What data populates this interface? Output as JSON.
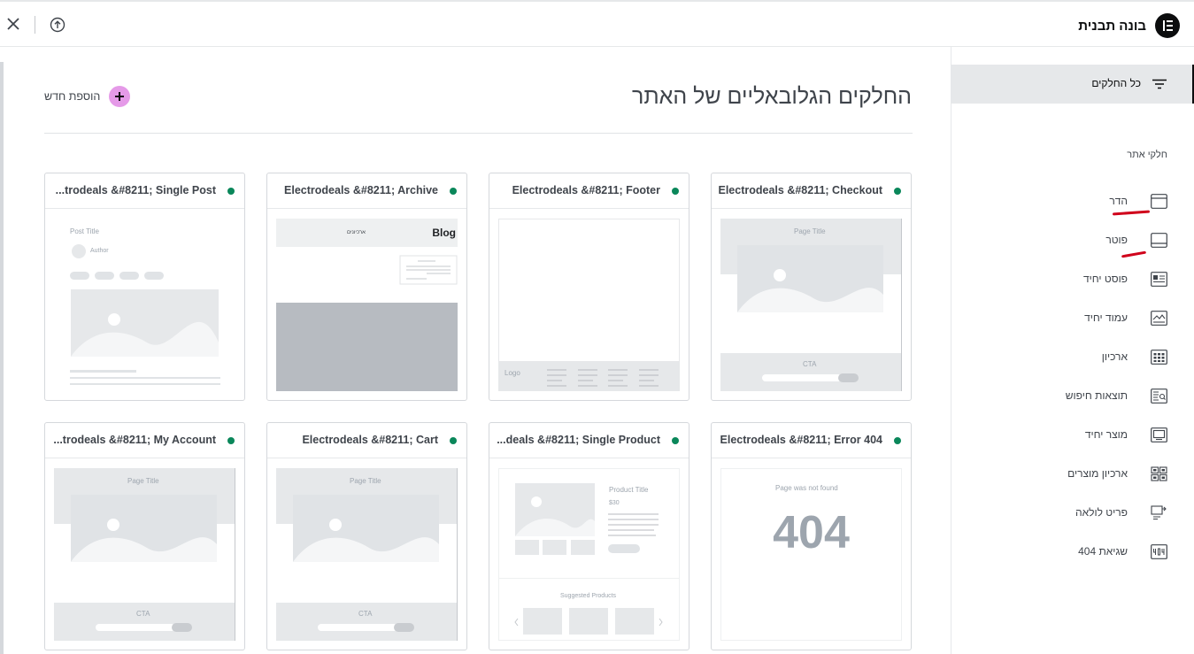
{
  "topbar": {
    "title": "בונה תבנית",
    "logo_icon": "elementor-logo",
    "close_icon": "close-icon",
    "upload_icon": "upload-icon"
  },
  "main": {
    "title": "החלקים הגלובאליים של האתר",
    "add_new_label": "הוספת חדש",
    "cards": [
      {
        "title": "Electrodeals &#8211; Checkout",
        "status_color": "#0a875a",
        "preview": {
          "page_title": "Page Title",
          "cta": "CTA"
        }
      },
      {
        "title": "Electrodeals &#8211; Footer",
        "status_color": "#0a875a",
        "preview": {
          "logo": "Logo"
        }
      },
      {
        "title": "Electrodeals &#8211; Archive",
        "status_color": "#0a875a",
        "preview": {
          "blog": "Blog",
          "archive": "ארכיונים"
        }
      },
      {
        "title": "...trodeals &#8211; Single Post",
        "status_color": "#0a875a",
        "preview": {
          "post_title": "Post Title",
          "author": "Author"
        }
      },
      {
        "title": "Electrodeals &#8211; Error 404",
        "status_color": "#0a875a",
        "preview": {
          "not_found": "Page was not found",
          "code": "404"
        }
      },
      {
        "title": "...deals &#8211; Single Product",
        "status_color": "#0a875a",
        "preview": {
          "product_title": "Product Title",
          "price": "$30",
          "suggested": "Suggested Products"
        }
      },
      {
        "title": "Electrodeals &#8211; Cart",
        "status_color": "#0a875a",
        "preview": {
          "page_title": "Page Title",
          "cta": "CTA"
        }
      },
      {
        "title": "...trodeals &#8211; My Account",
        "status_color": "#0a875a",
        "preview": {
          "page_title": "Page Title",
          "cta": "CTA"
        }
      }
    ]
  },
  "sidebar": {
    "all_parts_label": "כל החלקים",
    "all_parts_icon": "filter-icon",
    "section_title": "חלקי אתר",
    "items": [
      {
        "label": "הדר",
        "icon": "header-icon"
      },
      {
        "label": "פוטר",
        "icon": "footer-icon"
      },
      {
        "label": "פוסט יחיד",
        "icon": "single-post-icon"
      },
      {
        "label": "עמוד יחיד",
        "icon": "single-page-icon"
      },
      {
        "label": "ארכיון",
        "icon": "archive-icon"
      },
      {
        "label": "תוצאות חיפוש",
        "icon": "search-results-icon"
      },
      {
        "label": "מוצר יחיד",
        "icon": "single-product-icon"
      },
      {
        "label": "ארכיון מוצרים",
        "icon": "products-archive-icon"
      },
      {
        "label": "פריט לולאה",
        "icon": "loop-item-icon"
      },
      {
        "label": "שגיאת 404",
        "icon": "error-404-icon"
      }
    ]
  },
  "colors": {
    "accent": "#e59ae8",
    "status": "#0a875a",
    "annotation": "#d0021b",
    "active_bg": "#e6e8ea"
  }
}
